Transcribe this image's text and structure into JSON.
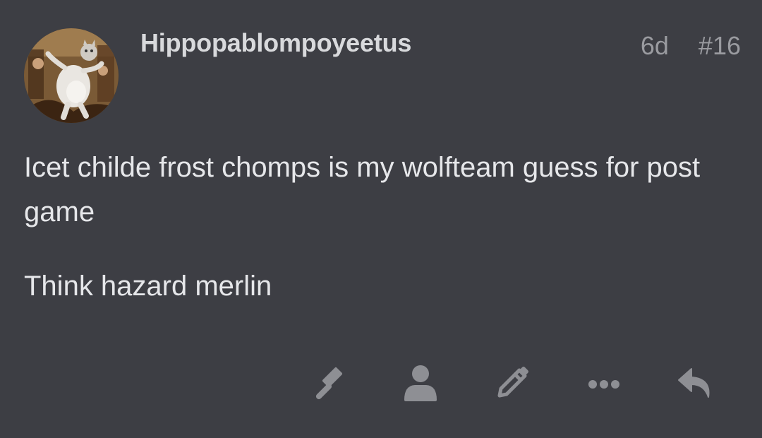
{
  "post": {
    "username": "Hippopablompoyeetus",
    "age": "6d",
    "post_number": "#16",
    "paragraphs": [
      "Icet childe frost chomps is my wolfteam guess for post game",
      "Think hazard merlin"
    ]
  },
  "actions": [
    {
      "icon": "gavel-icon"
    },
    {
      "icon": "user-icon"
    },
    {
      "icon": "pencil-icon"
    },
    {
      "icon": "ellipsis-icon"
    },
    {
      "icon": "reply-icon"
    }
  ],
  "colors": {
    "background": "#3d3e44",
    "text": "#e6e7ea",
    "muted": "#9a9ba0",
    "icon": "#8e8f94"
  }
}
